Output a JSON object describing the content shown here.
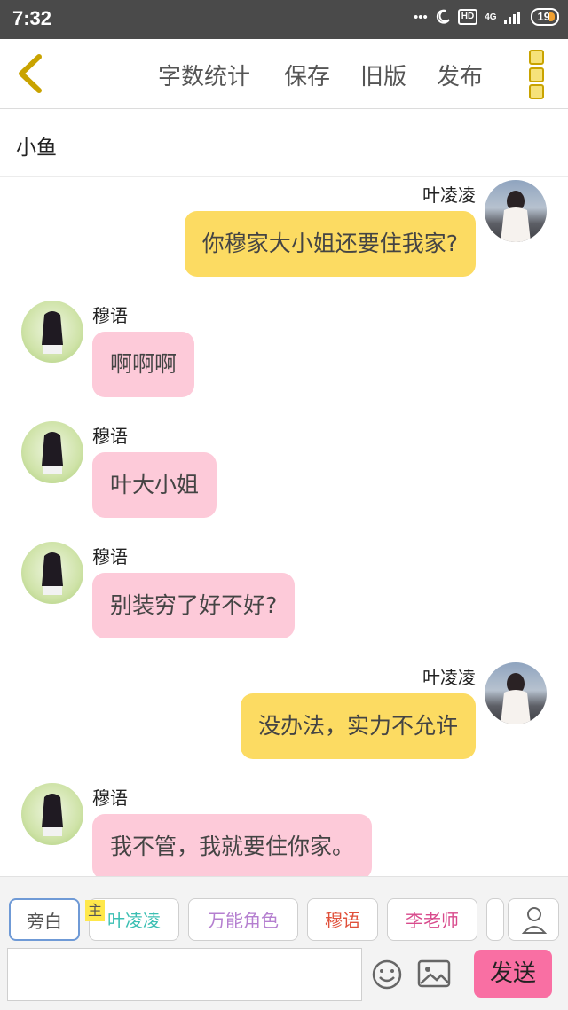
{
  "status_bar": {
    "time": "7:32",
    "dots": "•••",
    "hd": "HD",
    "network": "4G",
    "battery": "19"
  },
  "toolbar": {
    "word_count": "字数统计",
    "save": "保存",
    "old_version": "旧版",
    "publish": "发布"
  },
  "story": {
    "title": "小鱼"
  },
  "messages": [
    {
      "side": "right",
      "sender": "叶凌凌",
      "text": "你穆家大小姐还要住我家?",
      "bubble_color": "#fcdb62"
    },
    {
      "side": "left",
      "sender": "穆语",
      "text": "啊啊啊",
      "bubble_color": "#fdcad9"
    },
    {
      "side": "left",
      "sender": "穆语",
      "text": "叶大小姐",
      "bubble_color": "#fdcad9"
    },
    {
      "side": "left",
      "sender": "穆语",
      "text": "别装穷了好不好?",
      "bubble_color": "#fdcad9"
    },
    {
      "side": "right",
      "sender": "叶凌凌",
      "text": "没办法，实力不允许",
      "bubble_color": "#fcdb62"
    },
    {
      "side": "left",
      "sender": "穆语",
      "text": "我不管，我就要住你家。",
      "bubble_color": "#fdcad9"
    }
  ],
  "roles": {
    "narration": "旁白",
    "main_tag": "主",
    "items": [
      {
        "label": "叶凌凌",
        "color": "#3bbfb3"
      },
      {
        "label": "万能角色",
        "color": "#b57fd0"
      },
      {
        "label": "穆语",
        "color": "#e0503a"
      },
      {
        "label": "李老师",
        "color": "#d84a8c"
      }
    ]
  },
  "composer": {
    "input_value": "",
    "send_label": "发送"
  },
  "icons": {
    "back": "chevron-left-icon",
    "menu": "more-menu-icon",
    "person": "person-icon",
    "emoji": "smiley-icon",
    "image": "image-icon"
  },
  "colors": {
    "accent": "#f96fa3",
    "menu_icon": "#c9a300"
  }
}
